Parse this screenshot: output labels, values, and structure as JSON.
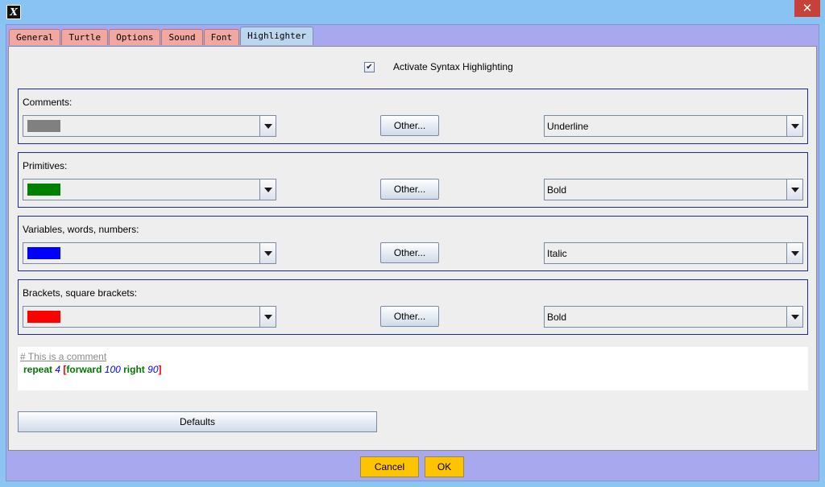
{
  "window": {
    "app_icon_glyph": "X",
    "close_glyph": "✕"
  },
  "tabs": [
    {
      "label": "General"
    },
    {
      "label": "Turtle"
    },
    {
      "label": "Options"
    },
    {
      "label": "Sound"
    },
    {
      "label": "Font"
    },
    {
      "label": "Highlighter",
      "active": true
    }
  ],
  "activate": {
    "checked_glyph": "✔",
    "label": "Activate Syntax Highlighting"
  },
  "groups": [
    {
      "label": "Comments:",
      "color": "#808080",
      "other_label": "Other...",
      "style": "Underline"
    },
    {
      "label": "Primitives:",
      "color": "#008000",
      "other_label": "Other...",
      "style": "Bold"
    },
    {
      "label": "Variables, words, numbers:",
      "color": "#0000ff",
      "other_label": "Other...",
      "style": "Italic"
    },
    {
      "label": "Brackets, square brackets:",
      "color": "#ff0000",
      "other_label": "Other...",
      "style": "Bold"
    }
  ],
  "preview": {
    "comment": "# This is a comment",
    "tokens": [
      "repeat",
      "4",
      "[",
      "forward",
      "100",
      "right",
      "90",
      "]"
    ]
  },
  "buttons": {
    "defaults": "Defaults",
    "cancel": "Cancel",
    "ok": "OK"
  }
}
